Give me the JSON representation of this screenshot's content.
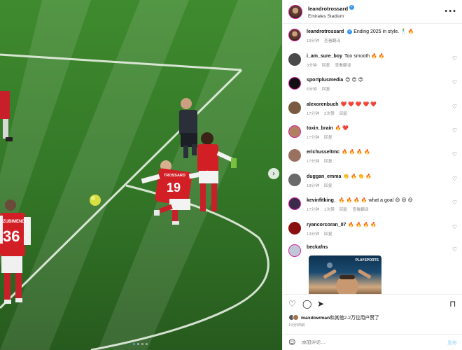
{
  "post": {
    "author": "leandrotrossard",
    "location": "Emirates Stadium",
    "caption_user": "leandrotrossard",
    "caption_text": "Ending 2025 in style. 🕺 🔥",
    "caption_time": "19分钟",
    "caption_translate": "查看翻译",
    "more_icon": "more-horizontal-icon"
  },
  "photo": {
    "jersey_left_name": "ZUBIMENDI",
    "jersey_left_number": "36",
    "jersey_center_name": "TROSSARD",
    "jersey_center_number": "19",
    "carousel_dots": 4,
    "carousel_active": 0
  },
  "comments": [
    {
      "user": "i_am_sure_boy",
      "text": "Too smooth 🔥 🔥",
      "time": "3分钟",
      "likes": "",
      "reply": "回复",
      "translate": "查看翻译",
      "avatar_color": "#4a4a4a"
    },
    {
      "user": "sportplusmedia",
      "text": "😍 😍 😍",
      "time": "6分钟",
      "likes": "",
      "reply": "回复",
      "translate": "",
      "avatar_color": "#111111"
    },
    {
      "user": "alexorenbuch",
      "text": "❤️ ❤️ ❤️ ❤️ ❤️",
      "time": "17分钟",
      "likes": "2次赞",
      "reply": "回复",
      "translate": "",
      "avatar_color": "#7a5a40"
    },
    {
      "user": "toxin_brain",
      "text": "🔥 ❤️",
      "time": "17分钟",
      "likes": "",
      "reply": "回复",
      "translate": "",
      "avatar_color": "#b08060"
    },
    {
      "user": "erichusseltmc",
      "text": "🔥 🔥 🔥 🔥",
      "time": "17分钟",
      "likes": "",
      "reply": "回复",
      "translate": "",
      "avatar_color": "#9a7060"
    },
    {
      "user": "duggan_emma",
      "text": "👏 🔥 👏 🔥",
      "time": "18分钟",
      "likes": "",
      "reply": "回复",
      "translate": "",
      "avatar_color": "#6a6a6a"
    },
    {
      "user": "kevinfitking_",
      "text": "🔥 🔥 🔥 🔥 what a goal 😍 😍 😍",
      "time": "17分钟",
      "likes": "1次赞",
      "reply": "回复",
      "translate": "查看翻译",
      "avatar_color": "#3a2a4a"
    },
    {
      "user": "ryancorcoran_07",
      "text": "🔥 🔥 🔥 🔥",
      "time": "13分钟",
      "likes": "",
      "reply": "回复",
      "translate": "",
      "avatar_color": "#8a1010"
    },
    {
      "user": "beckafns",
      "text": "",
      "time": "",
      "likes": "",
      "reply": "",
      "translate": "",
      "avatar_color": "#c0c8d8"
    }
  ],
  "reel_thumb": {
    "logo_text": "PLAYSPORTS"
  },
  "actions": {
    "like_icon": "heart-icon",
    "comment_icon": "comment-icon",
    "share_icon": "share-icon",
    "save_icon": "bookmark-icon",
    "likes_user": "maxdowman",
    "likes_suffix": "和其他2.2万位用户赞了",
    "post_time": "19分钟前",
    "comment_placeholder": "添加评论...",
    "post_label": "发布",
    "emoji_icon": "emoji-icon"
  },
  "colors": {
    "pitch": "#2e6b24",
    "arsenal_red": "#d21f26",
    "verified": "#3897f0",
    "link_blue": "#b2dffc"
  }
}
